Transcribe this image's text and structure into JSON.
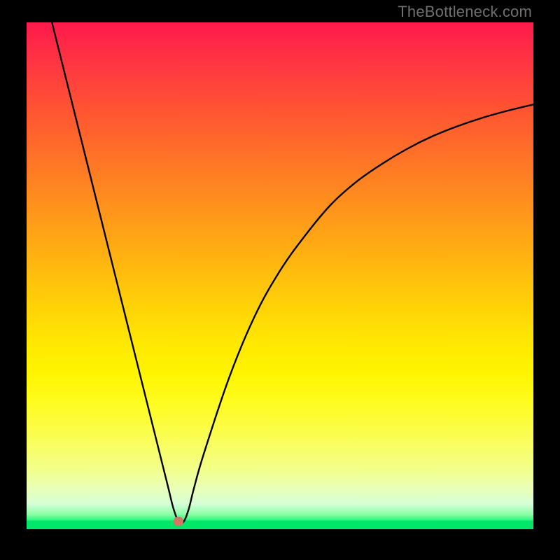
{
  "watermark": "TheBottleneck.com",
  "chart_data": {
    "type": "line",
    "title": "",
    "xlabel": "",
    "ylabel": "",
    "xlim": [
      0,
      100
    ],
    "ylim": [
      0,
      100
    ],
    "grid": false,
    "legend": false,
    "series": [
      {
        "name": "bottleneck-curve",
        "x": [
          5,
          10,
          15,
          20,
          25,
          26,
          27,
          28,
          29,
          30,
          31,
          32,
          33,
          35,
          40,
          45,
          50,
          55,
          60,
          65,
          70,
          75,
          80,
          85,
          90,
          95,
          100
        ],
        "y": [
          100,
          80,
          60,
          40,
          20,
          16,
          12,
          8,
          4,
          1.5,
          1.5,
          4,
          8,
          15,
          30,
          42,
          51,
          58,
          64,
          68.5,
          72,
          75,
          77.5,
          79.5,
          81.2,
          82.6,
          83.8
        ]
      }
    ],
    "marker": {
      "x": 30,
      "y": 1.5,
      "color": "#d17763"
    },
    "gradient_stops": [
      {
        "pos": 0,
        "color": "#ff1a4b"
      },
      {
        "pos": 0.5,
        "color": "#ffd207"
      },
      {
        "pos": 0.98,
        "color": "#2bf77a"
      },
      {
        "pos": 1.0,
        "color": "#00e66a"
      }
    ]
  }
}
